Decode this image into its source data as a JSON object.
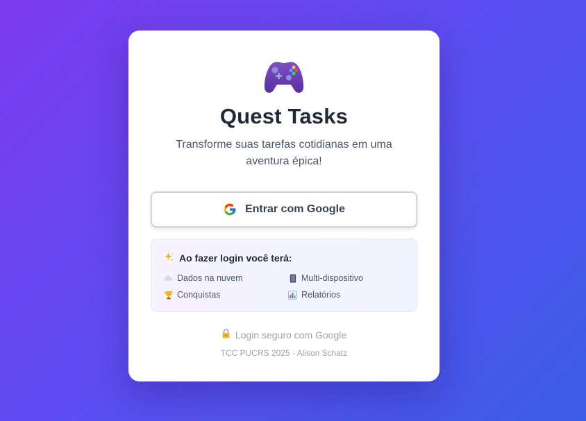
{
  "app": {
    "title": "Quest Tasks",
    "subtitle": "Transforme suas tarefas cotidianas em uma aventura épica!",
    "logo_icon": "game-controller-icon"
  },
  "login": {
    "google_button_label": "Entrar com Google",
    "google_icon": "google-g-icon"
  },
  "features": {
    "heading": "Ao fazer login você terá:",
    "heading_icon": "sparkles-icon",
    "items": [
      {
        "label": "Dados na nuvem",
        "icon": "cloud-icon"
      },
      {
        "label": "Multi-dispositivo",
        "icon": "mobile-phone-icon"
      },
      {
        "label": "Conquistas",
        "icon": "trophy-icon"
      },
      {
        "label": "Relatórios",
        "icon": "bar-chart-icon"
      }
    ]
  },
  "security": {
    "label": "Login seguro com Google",
    "icon": "lock-icon"
  },
  "footer": {
    "text": "TCC PUCRS 2025 - Alison Schatz"
  },
  "colors": {
    "background_start": "#7c3aed",
    "background_end": "#3b5ce8",
    "card": "#ffffff",
    "title": "#1f2937",
    "muted": "#9ca3af"
  }
}
